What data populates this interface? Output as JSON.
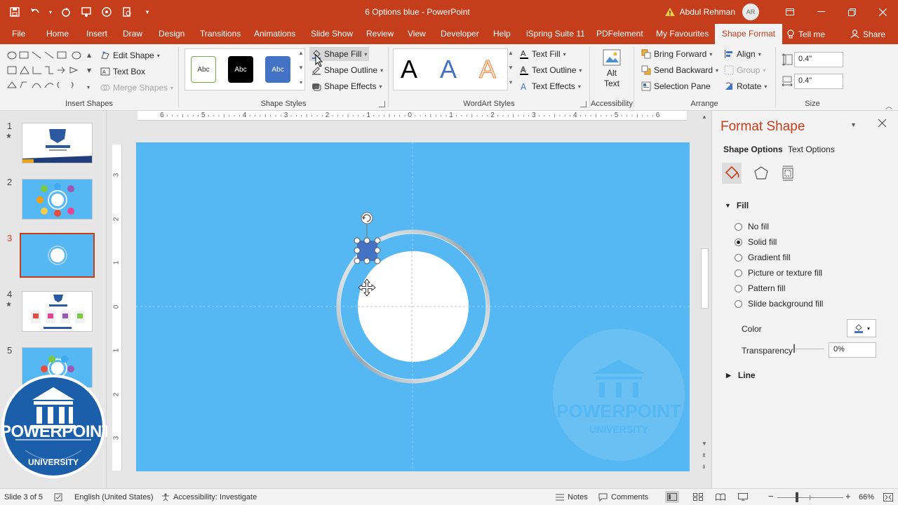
{
  "window": {
    "doc_title": "6 Options blue  -  PowerPoint",
    "user_name": "Abdul Rehman",
    "user_initials": "AR"
  },
  "tabs": [
    {
      "label": "File"
    },
    {
      "label": "Home"
    },
    {
      "label": "Insert"
    },
    {
      "label": "Draw"
    },
    {
      "label": "Design"
    },
    {
      "label": "Transitions"
    },
    {
      "label": "Animations"
    },
    {
      "label": "Slide Show"
    },
    {
      "label": "Review"
    },
    {
      "label": "View"
    },
    {
      "label": "Developer"
    },
    {
      "label": "Help"
    },
    {
      "label": "iSpring Suite 11"
    },
    {
      "label": "PDFelement"
    },
    {
      "label": "My Favourites"
    },
    {
      "label": "Shape Format"
    }
  ],
  "tell_me": "Tell me",
  "share": "Share",
  "ribbon": {
    "insert_shapes": {
      "edit_shape": "Edit Shape",
      "text_box": "Text Box",
      "merge_shapes": "Merge Shapes",
      "label": "Insert Shapes"
    },
    "shape_styles": {
      "style_text": "Abc",
      "shape_fill": "Shape Fill",
      "shape_outline": "Shape Outline",
      "shape_effects": "Shape Effects",
      "label": "Shape Styles"
    },
    "wordart": {
      "letter": "A",
      "text_fill": "Text Fill",
      "text_outline": "Text Outline",
      "text_effects": "Text Effects",
      "label": "WordArt Styles"
    },
    "accessibility": {
      "alt": "Alt",
      "text": "Text",
      "label": "Accessibility"
    },
    "arrange": {
      "bring_forward": "Bring Forward",
      "send_backward": "Send Backward",
      "selection_pane": "Selection Pane",
      "align": "Align",
      "group": "Group",
      "rotate": "Rotate",
      "label": "Arrange"
    },
    "size": {
      "height": "0.4\"",
      "width": "0.4\"",
      "label": "Size"
    }
  },
  "slides": [
    {
      "num": "1",
      "star": "★"
    },
    {
      "num": "2",
      "star": ""
    },
    {
      "num": "3",
      "star": ""
    },
    {
      "num": "4",
      "star": "★"
    },
    {
      "num": "5",
      "star": ""
    }
  ],
  "ruler": {
    "h": [
      "6",
      "5",
      "4",
      "3",
      "2",
      "1",
      "0",
      "1",
      "2",
      "3",
      "4",
      "5",
      "6"
    ],
    "v": [
      "3",
      "2",
      "1",
      "0",
      "1",
      "2",
      "3"
    ]
  },
  "format_pane": {
    "title": "Format Shape",
    "shape_options": "Shape Options",
    "text_options": "Text Options",
    "fill_header": "Fill",
    "fill_options": [
      {
        "label": "No fill",
        "selected": false
      },
      {
        "label": "Solid fill",
        "selected": true
      },
      {
        "label": "Gradient fill",
        "selected": false
      },
      {
        "label": "Picture or texture fill",
        "selected": false
      },
      {
        "label": "Pattern fill",
        "selected": false
      },
      {
        "label": "Slide background fill",
        "selected": false
      }
    ],
    "color_label": "Color",
    "transparency_label": "Transparency",
    "transparency_value": "0%",
    "line_header": "Line"
  },
  "status": {
    "slide_info": "Slide 3 of 5",
    "language": "English (United States)",
    "accessibility": "Accessibility: Investigate",
    "notes": "Notes",
    "comments": "Comments",
    "zoom": "66%"
  },
  "logo": {
    "line1": "POWERPOINT",
    "line2": "UNIVERSITY"
  },
  "colors": {
    "accent": "#c43e1c",
    "slide_bg": "#56b8f2",
    "shape_fill": "#4472c4"
  }
}
